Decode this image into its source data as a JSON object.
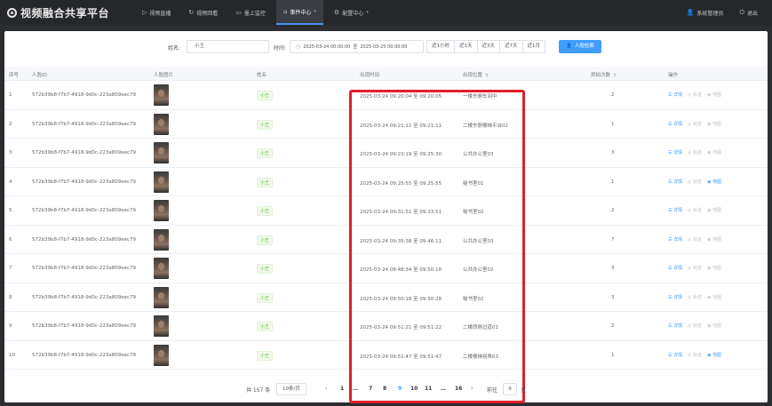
{
  "app": {
    "title": "视频融合共享平台"
  },
  "nav": [
    {
      "label": "视频直播",
      "icon": "play-circle-icon"
    },
    {
      "label": "视频回看",
      "icon": "history-icon"
    },
    {
      "label": "墨上监控",
      "icon": "monitor-icon"
    },
    {
      "label": "事件中心",
      "icon": "home-icon",
      "active": true
    },
    {
      "label": "配置中心",
      "icon": "settings-icon"
    }
  ],
  "user": {
    "name": "系统管理员",
    "logout": "退出"
  },
  "filters": {
    "name_label": "姓名:",
    "name_value": "小王",
    "time_label": "时间:",
    "date_start": "2025-03-24 00:00:00",
    "date_sep": "至",
    "date_end": "2025-03-25 00:00:00",
    "quick": [
      "近1小时",
      "近1天",
      "近3天",
      "近7天",
      "近1月"
    ],
    "search_button": "人脸检索"
  },
  "table": {
    "headers": {
      "index": "序号",
      "face_id": "人脸ID",
      "photo": "人脸图片",
      "name": "姓名",
      "time": "出现时间",
      "location": "出现位置",
      "count": "抓拍次数",
      "ops": "操作"
    },
    "op_labels": {
      "detail": "详情",
      "track": "轨迹",
      "map": "地图"
    },
    "rows": [
      {
        "index": "1",
        "face_id": "572b39b8-f7b7-4918-9d0c-223a809eec79",
        "name": "小王",
        "time": "2025-03-24 09:20:04 至 09:20:05",
        "location": "一楼东側车间中",
        "count": "2",
        "map_enabled": false
      },
      {
        "index": "2",
        "face_id": "572b39b8-f7b7-4918-9d0c-223a809eec79",
        "name": "小王",
        "time": "2025-03-24 09:21:11 至 09:21:11",
        "location": "二楼东侧楼梯平台02",
        "count": "1",
        "map_enabled": false
      },
      {
        "index": "3",
        "face_id": "572b39b8-f7b7-4918-9d0c-223a809eec79",
        "name": "小王",
        "time": "2025-03-24 09:23:19 至 09:25:30",
        "location": "公共办公室03",
        "count": "3",
        "map_enabled": false
      },
      {
        "index": "4",
        "face_id": "572b39b8-f7b7-4918-9d0c-223a809eec79",
        "name": "小王",
        "time": "2025-03-24 09:25:55 至 09:25:55",
        "location": "秘书室01",
        "count": "1",
        "map_enabled": true
      },
      {
        "index": "5",
        "face_id": "572b39b8-f7b7-4918-9d0c-223a809eec79",
        "name": "小王",
        "time": "2025-03-24 09:31:51 至 09:33:51",
        "location": "秘书室02",
        "count": "2",
        "map_enabled": false
      },
      {
        "index": "6",
        "face_id": "572b39b8-f7b7-4918-9d0c-223a809eec79",
        "name": "小王",
        "time": "2025-03-24 09:35:38 至 09:46:11",
        "location": "公共办公室03",
        "count": "7",
        "map_enabled": false
      },
      {
        "index": "7",
        "face_id": "572b39b8-f7b7-4918-9d0c-223a809eec79",
        "name": "小王",
        "time": "2025-03-24 09:48:34 至 09:50:10",
        "location": "公共办公室02",
        "count": "3",
        "map_enabled": false
      },
      {
        "index": "8",
        "face_id": "572b39b8-f7b7-4918-9d0c-223a809eec79",
        "name": "小王",
        "time": "2025-03-24 09:50:18 至 09:50:28",
        "location": "秘书室02",
        "count": "3",
        "map_enabled": false
      },
      {
        "index": "9",
        "face_id": "572b39b8-f7b7-4918-9d0c-223a809eec79",
        "name": "小王",
        "time": "2025-03-24 09:51:21 至 09:51:22",
        "location": "二楼西侧过道01",
        "count": "2",
        "map_enabled": false
      },
      {
        "index": "10",
        "face_id": "572b39b8-f7b7-4918-9d0c-223a809eec79",
        "name": "小王",
        "time": "2025-03-24 09:51:47 至 09:51:47",
        "location": "二楼楼梯拐角03",
        "count": "1",
        "map_enabled": true
      }
    ]
  },
  "pagination": {
    "total": "共 157 条",
    "page_size": "10条/页",
    "prev": "‹",
    "pages": [
      "1",
      "…",
      "7",
      "8",
      "9",
      "10",
      "11",
      "…",
      "16"
    ],
    "current_page": "9",
    "next": "›",
    "jump_label": "前往",
    "jump_value": "9",
    "jump_suffix": "页"
  },
  "colors": {
    "accent": "#409eff",
    "highlight": "#e0202a",
    "tag_green": "#67c23a",
    "topbar": "#25272b"
  }
}
